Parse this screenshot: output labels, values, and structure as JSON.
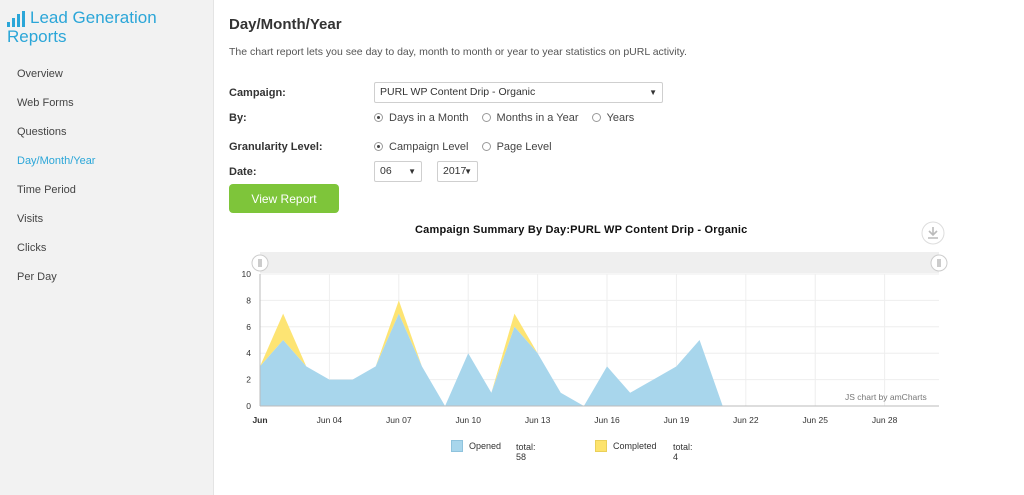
{
  "sidebar": {
    "brand_title": "Lead Generation Reports",
    "brand_line1": "Lead Generation",
    "brand_line2": "Reports",
    "items": [
      {
        "label": "Overview",
        "active": false
      },
      {
        "label": "Web Forms",
        "active": false
      },
      {
        "label": "Questions",
        "active": false
      },
      {
        "label": "Day/Month/Year",
        "active": true
      },
      {
        "label": "Time Period",
        "active": false
      },
      {
        "label": "Visits",
        "active": false
      },
      {
        "label": "Clicks",
        "active": false
      },
      {
        "label": "Per Day",
        "active": false
      }
    ]
  },
  "main": {
    "title": "Day/Month/Year",
    "description": "The chart report lets you see day to day, month to month or year to year statistics on pURL activity.",
    "campaign": {
      "label": "Campaign:",
      "value": "PURL WP Content Drip - Organic"
    },
    "by": {
      "label": "By:",
      "options": [
        "Days in a Month",
        "Months in a Year",
        "Years"
      ],
      "selected": "Days in a Month"
    },
    "granularity": {
      "label": "Granularity Level:",
      "options": [
        "Campaign Level",
        "Page Level"
      ],
      "selected": "Campaign Level"
    },
    "date": {
      "label": "Date:",
      "month": "06",
      "year": "2017"
    },
    "view_button": "View Report"
  },
  "chart": {
    "credit": "JS chart by amCharts",
    "legend": [
      {
        "name": "Opened",
        "total_text": "total: 58",
        "color": "#a8d6ec"
      },
      {
        "name": "Completed",
        "total_text": "total: 4",
        "color": "#fde36c"
      }
    ]
  },
  "chart_data": {
    "type": "area",
    "stacked": true,
    "title": "Campaign Summary By Day:PURL WP Content Drip - Organic",
    "xlabel": "",
    "ylabel": "",
    "x": [
      1,
      2,
      3,
      4,
      5,
      6,
      7,
      8,
      9,
      10,
      11,
      12,
      13,
      14,
      15,
      16,
      17,
      18,
      19,
      20,
      21,
      22,
      23,
      24,
      25,
      26,
      27,
      28,
      29,
      30
    ],
    "x_tick_labels": [
      {
        "day": 1,
        "label": "Jun"
      },
      {
        "day": 4,
        "label": "Jun 04"
      },
      {
        "day": 7,
        "label": "Jun 07"
      },
      {
        "day": 10,
        "label": "Jun 10"
      },
      {
        "day": 13,
        "label": "Jun 13"
      },
      {
        "day": 16,
        "label": "Jun 16"
      },
      {
        "day": 19,
        "label": "Jun 19"
      },
      {
        "day": 22,
        "label": "Jun 22"
      },
      {
        "day": 25,
        "label": "Jun 25"
      },
      {
        "day": 28,
        "label": "Jun 28"
      }
    ],
    "y_ticks": [
      0,
      2,
      4,
      6,
      8,
      10
    ],
    "ylim": [
      0,
      10
    ],
    "grid": true,
    "series": [
      {
        "name": "Opened",
        "color": "#a8d6ec",
        "values": [
          3,
          5,
          3,
          2,
          2,
          3,
          7,
          3,
          0,
          4,
          1,
          6,
          4,
          1,
          0,
          3,
          1,
          2,
          3,
          5,
          0,
          0,
          0,
          0,
          0,
          0,
          0,
          0,
          0,
          0
        ]
      },
      {
        "name": "Completed",
        "color": "#fde36c",
        "values": [
          0,
          2,
          0,
          0,
          0,
          0,
          1,
          0,
          0,
          0,
          0,
          1,
          0,
          0,
          0,
          0,
          0,
          0,
          0,
          0,
          0,
          0,
          0,
          0,
          0,
          0,
          0,
          0,
          0,
          0
        ]
      }
    ]
  }
}
